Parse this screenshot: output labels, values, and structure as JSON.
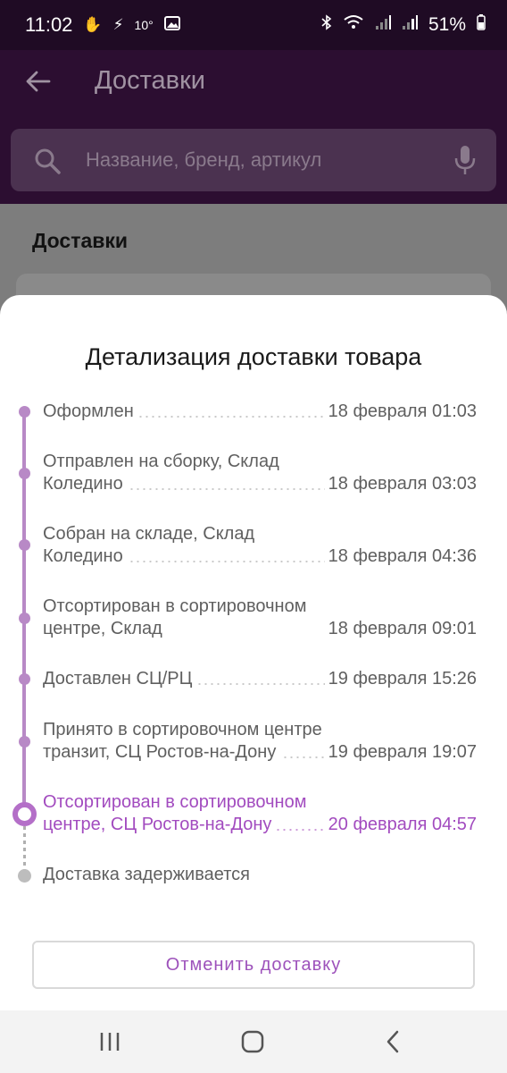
{
  "status_bar": {
    "time": "11:02",
    "temperature": "10°",
    "battery": "51%"
  },
  "header": {
    "title": "Доставки",
    "search_placeholder": "Название, бренд, артикул"
  },
  "page": {
    "title": "Доставки"
  },
  "sheet": {
    "title": "Детализация доставки товара",
    "events": [
      {
        "name": "Оформлен",
        "date": "18 февраля 01:03"
      },
      {
        "name": "Отправлен на сборку, Склад Коледино",
        "date": "18 февраля 03:03"
      },
      {
        "name": "Собран на складе, Склад Коледино",
        "date": "18 февраля 04:36"
      },
      {
        "name": "Отсортирован в сортировочном центре, Склад",
        "date": "18 февраля 09:01"
      },
      {
        "name": "Доставлен СЦ/РЦ",
        "date": "19 февраля 15:26"
      },
      {
        "name": "Принято в сортировочном центре транзит, СЦ Ростов-на-Дону",
        "date": "19 февраля 19:07"
      },
      {
        "name": "Отсортирован в сортировочном центре, СЦ Ростов-на-Дону",
        "date": "20 февраля 04:57"
      },
      {
        "name": "Доставка задерживается",
        "date": ""
      }
    ],
    "cancel_label": "Отменить доставку"
  },
  "colors": {
    "accent": "#a24bbf",
    "timeline": "#b889c6",
    "header_bg": "#2c0e31"
  }
}
